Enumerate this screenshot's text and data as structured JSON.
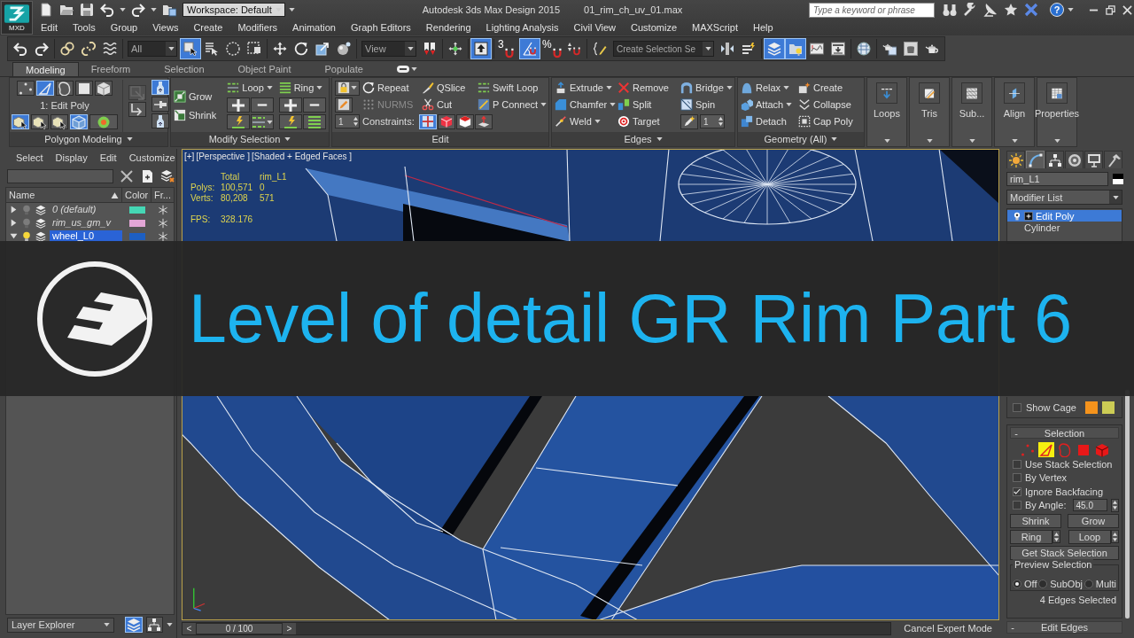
{
  "title_bar": {
    "app_button": "MXD",
    "workspace": "Workspace: Default",
    "app_title": "Autodesk 3ds Max Design 2015",
    "file_name": "01_rim_ch_uv_01.max",
    "search": {
      "placeholder": "Type a keyword or phrase"
    },
    "help": "?"
  },
  "menu": [
    "Edit",
    "Tools",
    "Group",
    "Views",
    "Create",
    "Modifiers",
    "Animation",
    "Graph Editors",
    "Rendering",
    "Lighting Analysis",
    "Civil View",
    "Customize",
    "MAXScript",
    "Help"
  ],
  "main_toolbar": [
    {
      "kind": "button",
      "on": false
    },
    {
      "kind": "button",
      "on": false
    },
    {
      "kind": "button",
      "on": false
    },
    {
      "kind": "button",
      "on": false
    },
    {
      "kind": "button",
      "on": false
    },
    {
      "kind": "dropdown",
      "value": "All"
    },
    {
      "kind": "button",
      "on": true
    },
    {
      "kind": "button",
      "on": false
    },
    {
      "kind": "button",
      "on": false
    },
    {
      "kind": "button",
      "on": false
    },
    {
      "kind": "button",
      "on": false
    },
    {
      "kind": "button",
      "on": false
    },
    {
      "kind": "button",
      "on": false
    },
    {
      "kind": "button",
      "on": false
    },
    {
      "kind": "dropdown",
      "value": "View"
    },
    {
      "kind": "button",
      "on": false
    },
    {
      "kind": "button",
      "on": false
    },
    {
      "kind": "button",
      "on": true
    },
    {
      "kind": "button",
      "on": false,
      "glyph": "3"
    },
    {
      "kind": "button",
      "on": true
    },
    {
      "kind": "button",
      "on": false,
      "glyph": "%"
    },
    {
      "kind": "button",
      "on": false
    },
    {
      "kind": "button",
      "on": false
    },
    {
      "kind": "dropdown",
      "value": "Create Selection Se"
    },
    {
      "kind": "button",
      "on": false
    },
    {
      "kind": "button",
      "on": false
    },
    {
      "kind": "button",
      "on": true
    },
    {
      "kind": "button",
      "on": true
    },
    {
      "kind": "button",
      "on": false
    },
    {
      "kind": "button",
      "on": false
    },
    {
      "kind": "button",
      "on": false
    },
    {
      "kind": "button",
      "on": false
    },
    {
      "kind": "button",
      "on": false
    },
    {
      "kind": "button",
      "on": false
    }
  ],
  "ribbon": {
    "tabs": [
      {
        "label": "Modeling",
        "selected": true
      },
      {
        "label": "Freeform",
        "selected": false
      },
      {
        "label": "Selection",
        "selected": false
      },
      {
        "label": "Object Paint",
        "selected": false
      },
      {
        "label": "Populate",
        "selected": false
      }
    ],
    "polygon_modeling": {
      "title": "Polygon Modeling",
      "dropdown": true,
      "levels": [
        {
          "selected": false
        },
        {
          "selected": true
        },
        {
          "selected": false
        },
        {
          "selected": false
        },
        {
          "selected": false
        }
      ],
      "stack_label": "1: Edit Poly",
      "tools": [
        {
          "on": true
        },
        {
          "on": false
        },
        {
          "on": false
        },
        {
          "on": true
        },
        {
          "on": false
        }
      ],
      "side_tools": [
        {
          "on": false,
          "disabled": true
        },
        {
          "on": false,
          "disabled": false
        },
        {
          "on": true,
          "disabled": false
        },
        {
          "on": false,
          "disabled": false
        },
        {
          "on": false,
          "disabled": false
        }
      ]
    },
    "modify_selection": {
      "title": "Modify Selection",
      "dropdown": true,
      "grow": "Grow",
      "shrink": "Shrink",
      "loop": "Loop",
      "ring": "Ring"
    },
    "edit": {
      "title": "Edit",
      "dropdown": false,
      "spinner": "1",
      "commands": [
        {
          "label": "Repeat",
          "disabled": false,
          "dropdown": false
        },
        {
          "label": "NURMS",
          "disabled": true,
          "dropdown": false
        },
        {
          "label": "QSlice",
          "disabled": false,
          "dropdown": false
        },
        {
          "label": "Cut",
          "disabled": false,
          "dropdown": false
        },
        {
          "label": "Swift Loop",
          "disabled": false,
          "dropdown": false
        },
        {
          "label": "P Connect",
          "disabled": false,
          "dropdown": true
        }
      ],
      "constraints_label": "Constraints:",
      "constraints": [
        {
          "selected": true
        },
        {
          "selected": false
        },
        {
          "selected": false
        },
        {
          "selected": false
        }
      ]
    },
    "edges": {
      "title": "Edges",
      "dropdown": true,
      "spinner": "1",
      "commands": [
        {
          "label": "Extrude",
          "disabled": false,
          "dropdown": true
        },
        {
          "label": "Chamfer",
          "disabled": false,
          "dropdown": true
        },
        {
          "label": "Weld",
          "disabled": false,
          "dropdown": true
        },
        {
          "label": "Remove",
          "disabled": false,
          "dropdown": false
        },
        {
          "label": "Split",
          "disabled": false,
          "dropdown": false
        },
        {
          "label": "Target",
          "disabled": false,
          "dropdown": false
        },
        {
          "label": "Bridge",
          "disabled": false,
          "dropdown": true
        },
        {
          "label": "Spin",
          "disabled": false,
          "dropdown": false
        }
      ]
    },
    "geometry": {
      "title": "Geometry (All)",
      "dropdown": true,
      "commands": [
        {
          "label": "Relax",
          "disabled": false,
          "dropdown": true
        },
        {
          "label": "Attach",
          "disabled": false,
          "dropdown": true
        },
        {
          "label": "Detach",
          "disabled": false,
          "dropdown": false
        },
        {
          "label": "Create",
          "disabled": false,
          "dropdown": false
        },
        {
          "label": "Collapse",
          "disabled": false,
          "dropdown": false
        },
        {
          "label": "Cap Poly",
          "disabled": false,
          "dropdown": false
        }
      ]
    },
    "big_buttons": [
      {
        "label": "Loops"
      },
      {
        "label": "Tris"
      },
      {
        "label": "Sub..."
      },
      {
        "label": "Align"
      },
      {
        "label": "Properties"
      }
    ]
  },
  "scene_explorer": {
    "menu": [
      "Select",
      "Display",
      "Edit",
      "Customize"
    ],
    "columns": [
      {
        "label": "Name",
        "sorted": true
      },
      {
        "label": "Color",
        "sorted": false
      },
      {
        "label": "Fr...",
        "sorted": false
      }
    ],
    "layers": [
      {
        "name": "0 (default)",
        "expanded": false,
        "current": false,
        "selected": false,
        "color": "#45d7b5"
      },
      {
        "name": "rim_us_gm_v",
        "expanded": false,
        "current": false,
        "selected": false,
        "color": "#e3a6d6"
      },
      {
        "name": "wheel_L0",
        "expanded": true,
        "current": true,
        "selected": true,
        "color": "#1d5fc2"
      }
    ],
    "explorer_mode": "Layer Explorer",
    "view_buttons": [
      {
        "selected": true
      },
      {
        "selected": false
      }
    ]
  },
  "viewport": {
    "labels": [
      "[+]",
      "[Perspective ]",
      "[Shaded + Edged Faces ]"
    ],
    "stats": {
      "header": [
        "Total",
        "rim_L1"
      ],
      "rows": [
        {
          "label": "Polys:",
          "values": [
            "100,571",
            "0"
          ]
        },
        {
          "label": "Verts:",
          "values": [
            "80,208",
            "571"
          ]
        },
        {
          "label": "FPS:",
          "values": [
            "328.176"
          ]
        }
      ]
    }
  },
  "time_slider": {
    "previous": "<",
    "position": "0 / 100",
    "next": ">",
    "level": 0
  },
  "status_bar": {
    "expert_mode": "Cancel Expert Mode"
  },
  "command_panel": {
    "tabs": [
      {
        "selected": false
      },
      {
        "selected": true
      },
      {
        "selected": false
      },
      {
        "selected": false
      },
      {
        "selected": false
      },
      {
        "selected": false
      }
    ],
    "object_name": "rim_L1",
    "modifier_list": "Modifier List",
    "stack": [
      {
        "name": "Edit Poly",
        "kind": "modifier",
        "selected": true
      },
      {
        "name": "Cylinder",
        "kind": "base",
        "selected": false
      }
    ],
    "show_cage": {
      "label": "Show Cage",
      "checked": false,
      "colors": [
        {
          "color": "#f5931c"
        },
        {
          "color": "#cccc55"
        }
      ]
    },
    "selection": {
      "toggle": "-",
      "title": "Selection",
      "levels": [
        {
          "selected": false
        },
        {
          "selected": true
        },
        {
          "selected": false
        },
        {
          "selected": false
        },
        {
          "selected": false
        }
      ],
      "options": [
        {
          "label": "Use Stack Selection",
          "checked": false
        },
        {
          "label": "By Vertex",
          "checked": false
        },
        {
          "label": "Ignore Backfacing",
          "checked": true
        },
        {
          "label": "By Angle:",
          "checked": false
        }
      ],
      "angle": "45.0",
      "shrink": "Shrink",
      "grow": "Grow",
      "ring": "Ring",
      "loop": "Loop",
      "get_stack": "Get Stack Selection",
      "preview": {
        "title": "Preview Selection",
        "options": [
          {
            "label": "Off",
            "selected": true
          },
          {
            "label": "SubObj",
            "selected": false
          },
          {
            "label": "Multi",
            "selected": false
          }
        ]
      },
      "status": "4 Edges Selected"
    },
    "next_rollout": {
      "toggle": "-",
      "title": "Edit Edges"
    }
  },
  "banner": {
    "title": "Level of detail GR Rim Part 6"
  }
}
